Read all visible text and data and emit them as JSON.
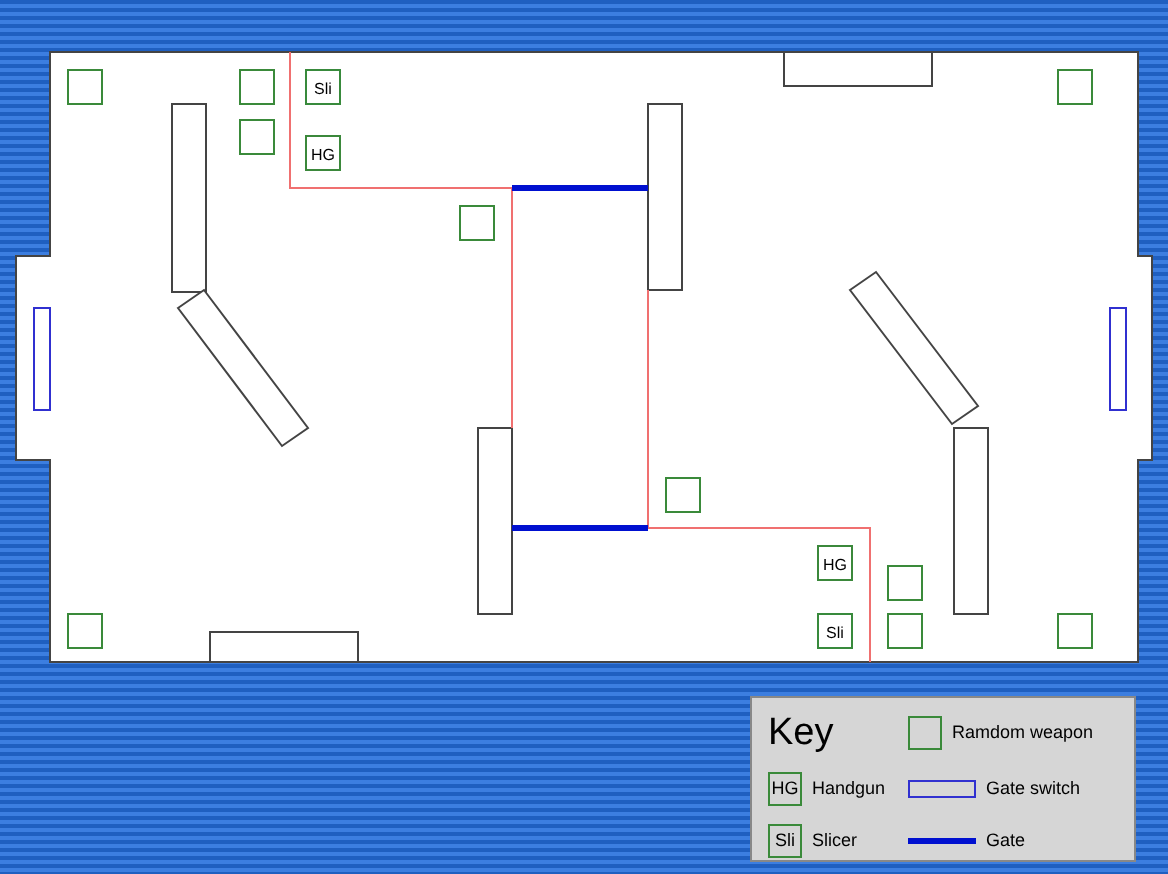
{
  "map": {
    "pickups": [
      {
        "kind": "random"
      },
      {
        "kind": "random"
      },
      {
        "kind": "random"
      },
      {
        "kind": "slicer",
        "label": "Sli"
      },
      {
        "kind": "handgun",
        "label": "HG"
      },
      {
        "kind": "random"
      },
      {
        "kind": "random"
      },
      {
        "kind": "random"
      },
      {
        "kind": "handgun",
        "label": "HG"
      },
      {
        "kind": "random"
      },
      {
        "kind": "slicer",
        "label": "Sli"
      },
      {
        "kind": "random"
      },
      {
        "kind": "random"
      },
      {
        "kind": "random"
      }
    ]
  },
  "key": {
    "title": "Key",
    "entries": [
      {
        "kind": "random",
        "label": "Ramdom weapon"
      },
      {
        "kind": "handgun",
        "symbol": "HG",
        "label": "Handgun"
      },
      {
        "kind": "switch",
        "label": "Gate switch"
      },
      {
        "kind": "slicer",
        "symbol": "Sli",
        "label": "Slicer"
      },
      {
        "kind": "gate",
        "label": "Gate"
      }
    ]
  }
}
